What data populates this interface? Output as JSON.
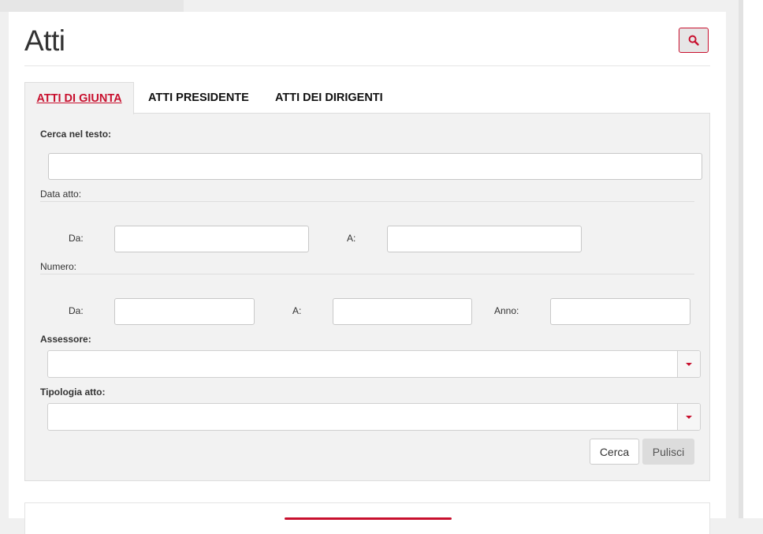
{
  "page": {
    "title": "Atti",
    "search_toggle_icon": "search-icon",
    "accent_color": "#c8102e"
  },
  "tabs": [
    {
      "label": "ATTI DI GIUNTA",
      "active": true
    },
    {
      "label": "ATTI PRESIDENTE",
      "active": false
    },
    {
      "label": "ATTI DEI DIRIGENTI",
      "active": false
    }
  ],
  "form": {
    "fulltext": {
      "label": "Cerca nel testo:",
      "value": ""
    },
    "data_atto": {
      "section_label": "Data atto:",
      "from_label": "Da:",
      "to_label": "A:",
      "from_value": "",
      "to_value": ""
    },
    "numero": {
      "section_label": "Numero:",
      "from_label": "Da:",
      "to_label": "A:",
      "year_label": "Anno:",
      "from_value": "",
      "to_value": "",
      "year_value": ""
    },
    "assessore": {
      "label": "Assessore:",
      "selected": ""
    },
    "tipologia": {
      "label": "Tipologia atto:",
      "selected": ""
    },
    "buttons": {
      "search": "Cerca",
      "reset": "Pulisci"
    }
  }
}
